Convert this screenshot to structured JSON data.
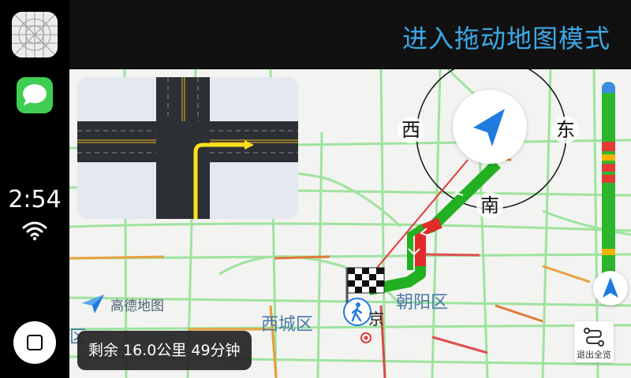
{
  "topbar": {
    "mode_label": "进入拖动地图模式"
  },
  "sidebar": {
    "time": "2:54",
    "apps": [
      {
        "name": "maps"
      },
      {
        "name": "messages"
      }
    ]
  },
  "map": {
    "brand": "高德地图",
    "remaining_info": "剩余 16.0公里 49分钟",
    "districts": [
      "西城区",
      "朝阳区",
      "京",
      "区"
    ],
    "compass": {
      "west": "西",
      "east": "东",
      "south": "南"
    },
    "exit_overview_label": "退出全览"
  },
  "colors": {
    "accent": "#3ba9e8",
    "route_green": "#22b022",
    "route_red": "#e12a2a",
    "traffic_green": "#2db62d",
    "traffic_red": "#e53935",
    "traffic_yellow": "#f5b400"
  }
}
